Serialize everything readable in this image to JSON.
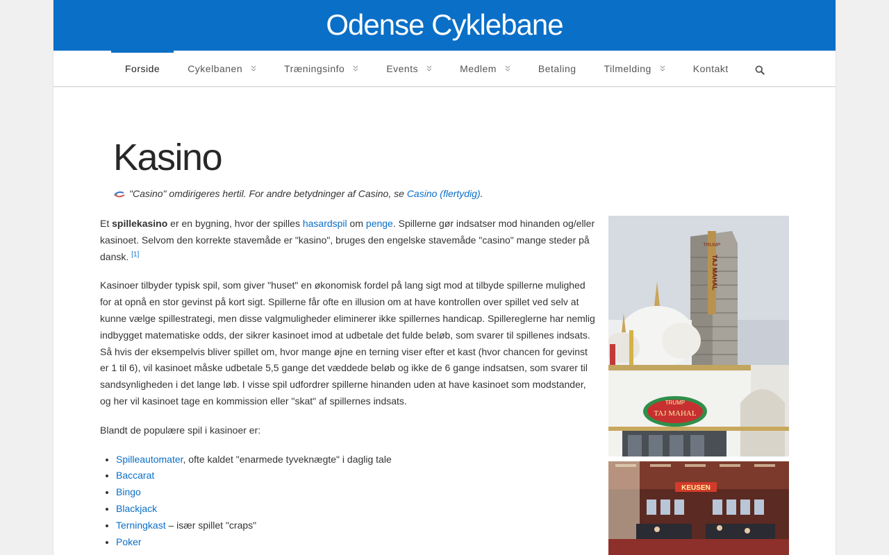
{
  "site": {
    "title": "Odense Cyklebane"
  },
  "nav": {
    "items": [
      {
        "label": "Forside"
      },
      {
        "label": "Cykelbanen"
      },
      {
        "label": "Træningsinfo"
      },
      {
        "label": "Events"
      },
      {
        "label": "Medlem"
      },
      {
        "label": "Betaling"
      },
      {
        "label": "Tilmelding"
      },
      {
        "label": "Kontakt"
      }
    ],
    "active_index": 0,
    "search_icon": "search-icon",
    "dropdown_icon": "chevron-double-down-icon"
  },
  "page": {
    "title": "Kasino",
    "hatnote": {
      "icon": "disambiguation-icon",
      "text": "\"Casino\" omdirigeres hertil. For andre betydninger af Casino, se",
      "link": "Casino (flertydig)",
      "end": "."
    },
    "p1": {
      "t1": "Et ",
      "bold": "spillekasino",
      "t2": " er en bygning, hvor der spilles ",
      "link1": "hasardspil",
      "t3": " om ",
      "link2": "penge",
      "t4": ". Spillerne gør indsatser mod hinanden og/eller kasinoet. Selvom den korrekte stavemåde er \"kasino\", bruges den engelske stavemåde \"casino\" mange steder på dansk. ",
      "ref": "[1]"
    },
    "p2": "Kasinoer tilbyder typisk spil, som giver \"huset\" en økonomisk fordel på lang sigt mod at tilbyde spillerne mulighed for at opnå en stor gevinst på kort sigt. Spillerne får ofte en illusion om at have kontrollen over spillet ved selv at kunne vælge spillestrategi, men disse valgmuligheder eliminerer ikke spillernes handicap. Spillereglerne har nemlig indbygget matematiske odds, der sikrer kasinoet imod at udbetale det fulde beløb, som svarer til spillenes indsats. Så hvis der eksempelvis bliver spillet om, hvor mange øjne en terning viser efter et kast (hvor chancen for gevinst er 1 til 6), vil kasinoet måske udbetale 5,5 gange det væddede beløb og ikke de 6 gange indsatsen, som svarer til sandsynligheden i det lange løb. I visse spil udfordrer spillerne hinanden uden at have kasinoet som modstander, og her vil kasinoet tage en kommission eller \"skat\" af spillernes indsats.",
    "p3": "Blandt de populære spil i kasinoer er:",
    "games": [
      {
        "link": "Spilleautomater",
        "rest": ", ofte kaldet \"enarmede tyveknægte\" i daglig tale"
      },
      {
        "link": "Baccarat",
        "rest": ""
      },
      {
        "link": "Bingo",
        "rest": ""
      },
      {
        "link": "Blackjack",
        "rest": ""
      },
      {
        "link": "Terningkast",
        "rest": " – især spillet \"craps\""
      },
      {
        "link": "Poker",
        "rest": ""
      }
    ],
    "photo1": {
      "sign_top": "TRUMP",
      "tower": "TAJ MAHAL",
      "sign_low_top": "TRUMP",
      "sign_low": "TAJ MAHAL"
    },
    "photo2": {
      "sign": "KEUSEN"
    }
  },
  "colors": {
    "brand": "#0a6fc7",
    "link": "#0a6fc7"
  }
}
